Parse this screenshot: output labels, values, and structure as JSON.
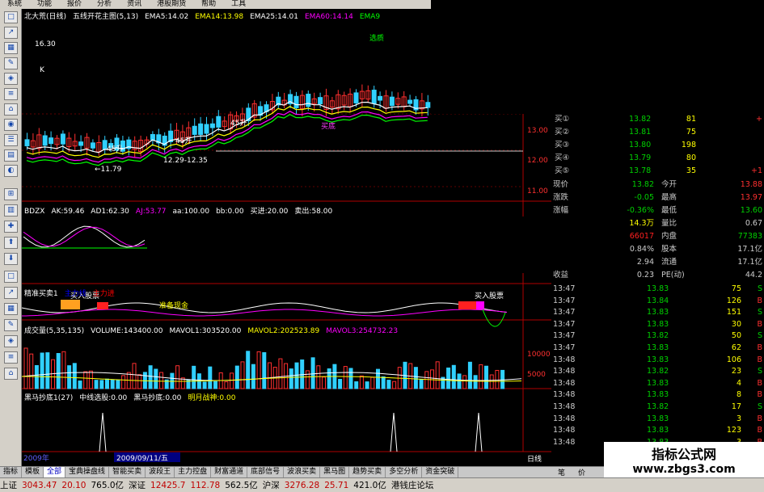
{
  "menu": [
    "系统",
    "功能",
    "报价",
    "分析",
    "资讯",
    "港股期货",
    "帮助",
    "工具"
  ],
  "main_chart": {
    "header": [
      {
        "text": "北大荒(日线)",
        "color": "#ffffff"
      },
      {
        "text": "五线开花主图(5,13)",
        "color": "#ffffff"
      },
      {
        "text": "EMA5:14.02",
        "color": "#ffffff"
      },
      {
        "text": "EMA14:13.98",
        "color": "#ffff00"
      },
      {
        "text": "EMA25:14.01",
        "color": "#ffffff"
      },
      {
        "text": "EMA60:14.14",
        "color": "#ff00ff"
      },
      {
        "text": "EMA9",
        "color": "#00ff00"
      }
    ],
    "price_labels": [
      "13.00",
      "12.00",
      "11.00"
    ],
    "annotations": {
      "high": "16.30",
      "low": "11.79",
      "range": "12.29-12.35",
      "up1": "45升",
      "up2": "45升",
      "up3": "45升",
      "buy": "买底",
      "sell": "选质",
      "k": "K"
    }
  },
  "bdzx": {
    "header": [
      {
        "text": "BDZX",
        "color": "#ffffff"
      },
      {
        "text": "AK:59.46",
        "color": "#ffffff"
      },
      {
        "text": "AD1:62.30",
        "color": "#ffffff"
      },
      {
        "text": "AJ:53.77",
        "color": "#ff00ff"
      },
      {
        "text": "aa:100.00",
        "color": "#ffffff"
      },
      {
        "text": "bb:0.00",
        "color": "#ffffff"
      },
      {
        "text": "买进:20.00",
        "color": "#ffffff"
      },
      {
        "text": "卖出:58.00",
        "color": "#ffffff"
      }
    ]
  },
  "jingzhun": {
    "header": [
      {
        "text": "精准买卖1",
        "color": "#ffffff"
      },
      {
        "text": "主力线",
        "color": "#0000ff"
      },
      {
        "text": "主力进",
        "color": "#ff0000"
      }
    ],
    "labels": {
      "buy1": "买入股票",
      "buy2": "买入股票",
      "ready": "准备现金"
    }
  },
  "volume": {
    "header": [
      {
        "text": "成交量(5,35,135)",
        "color": "#ffffff"
      },
      {
        "text": "VOLUME:143400.00",
        "color": "#ffffff"
      },
      {
        "text": "MAVOL1:303520.00",
        "color": "#ffffff"
      },
      {
        "text": "MAVOL2:202523.89",
        "color": "#ffff00"
      },
      {
        "text": "MAVOL3:254732.23",
        "color": "#ff00ff"
      }
    ],
    "scale_labels": [
      "10000",
      "5000"
    ]
  },
  "heima": {
    "header": [
      {
        "text": "黑马抄底1(27)",
        "color": "#ffffff"
      },
      {
        "text": "中线选股:0.00",
        "color": "#ffffff"
      },
      {
        "text": "黑马抄底:0.00",
        "color": "#ffffff"
      },
      {
        "text": "明月战神:0.00",
        "color": "#ffff00"
      }
    ],
    "date_label": "2009/09/11/五",
    "year_label": "2009年",
    "period": "日线"
  },
  "quote": {
    "bids": [
      {
        "label": "买①",
        "price": "13.82",
        "vol": "81",
        "extra": "+"
      },
      {
        "label": "买②",
        "price": "13.81",
        "vol": "75",
        "extra": ""
      },
      {
        "label": "买③",
        "price": "13.80",
        "vol": "198",
        "extra": ""
      },
      {
        "label": "买④",
        "price": "13.79",
        "vol": "80",
        "extra": ""
      },
      {
        "label": "买⑤",
        "price": "13.78",
        "vol": "35",
        "extra": "+1"
      }
    ],
    "stats": [
      {
        "l1": "现价",
        "v1": "13.82",
        "l2": "今开",
        "v2": "13.88"
      },
      {
        "l1": "涨跌",
        "v1": "-0.05",
        "l2": "最高",
        "v2": "13.97"
      },
      {
        "l1": "涨幅",
        "v1": "-0.36%",
        "l2": "最低",
        "v2": "13.60"
      },
      {
        "l1": "",
        "v1": "14.3万",
        "l2": "量比",
        "v2": "0.67"
      },
      {
        "l1": "",
        "v1": "66017",
        "l2": "内盘",
        "v2": "77383"
      },
      {
        "l1": "",
        "v1": "0.84%",
        "l2": "股本",
        "v2": "17.1亿"
      },
      {
        "l1": "",
        "v1": "2.94",
        "l2": "流通",
        "v2": "17.1亿"
      },
      {
        "l1": "收益",
        "v1": "0.23",
        "l2": "PE(动)",
        "v2": "44.2"
      }
    ],
    "ticks": [
      {
        "t": "13:47",
        "p": "13.83",
        "v": "75",
        "d": "S"
      },
      {
        "t": "13:47",
        "p": "13.84",
        "v": "126",
        "d": "B"
      },
      {
        "t": "13:47",
        "p": "13.83",
        "v": "151",
        "d": "S"
      },
      {
        "t": "13:47",
        "p": "13.83",
        "v": "30",
        "d": "B"
      },
      {
        "t": "13:47",
        "p": "13.82",
        "v": "50",
        "d": "S"
      },
      {
        "t": "13:47",
        "p": "13.83",
        "v": "62",
        "d": "B"
      },
      {
        "t": "13:48",
        "p": "13.83",
        "v": "106",
        "d": "B"
      },
      {
        "t": "13:48",
        "p": "13.82",
        "v": "23",
        "d": "S"
      },
      {
        "t": "13:48",
        "p": "13.83",
        "v": "4",
        "d": "B"
      },
      {
        "t": "13:48",
        "p": "13.83",
        "v": "8",
        "d": "B"
      },
      {
        "t": "13:48",
        "p": "13.82",
        "v": "17",
        "d": "S"
      },
      {
        "t": "13:48",
        "p": "13.83",
        "v": "3",
        "d": "B"
      },
      {
        "t": "13:48",
        "p": "13.83",
        "v": "123",
        "d": "B"
      },
      {
        "t": "13:48",
        "p": "13.83",
        "v": "3",
        "d": "B"
      }
    ]
  },
  "tabs": [
    "指标",
    "模板",
    "全部",
    "宝典操盘线",
    "智能买卖",
    "波段王",
    "主力控盘",
    "财富通道",
    "底部信号",
    "波浪买卖",
    "黑马图",
    "趋势买卖",
    "多空分析",
    "资金突破"
  ],
  "right_tabs": [
    "笔",
    "价"
  ],
  "status": [
    {
      "text": "上证",
      "color": "#000000"
    },
    {
      "text": "3043.47",
      "color": "#c00000"
    },
    {
      "text": "20.10",
      "color": "#c00000"
    },
    {
      "text": "765.0亿",
      "color": "#000000"
    },
    {
      "text": "深证",
      "color": "#000000"
    },
    {
      "text": "12425.7",
      "color": "#c00000"
    },
    {
      "text": "112.78",
      "color": "#c00000"
    },
    {
      "text": "562.5亿",
      "color": "#000000"
    },
    {
      "text": "沪深",
      "color": "#000000"
    },
    {
      "text": "3276.28",
      "color": "#c00000"
    },
    {
      "text": "25.71",
      "color": "#c00000"
    },
    {
      "text": "421.0亿",
      "color": "#000000"
    },
    {
      "text": "港钱庄论坛",
      "color": "#000000"
    }
  ],
  "watermark": {
    "line1": "指标公式网",
    "line2": "www.zbgs3.com"
  }
}
